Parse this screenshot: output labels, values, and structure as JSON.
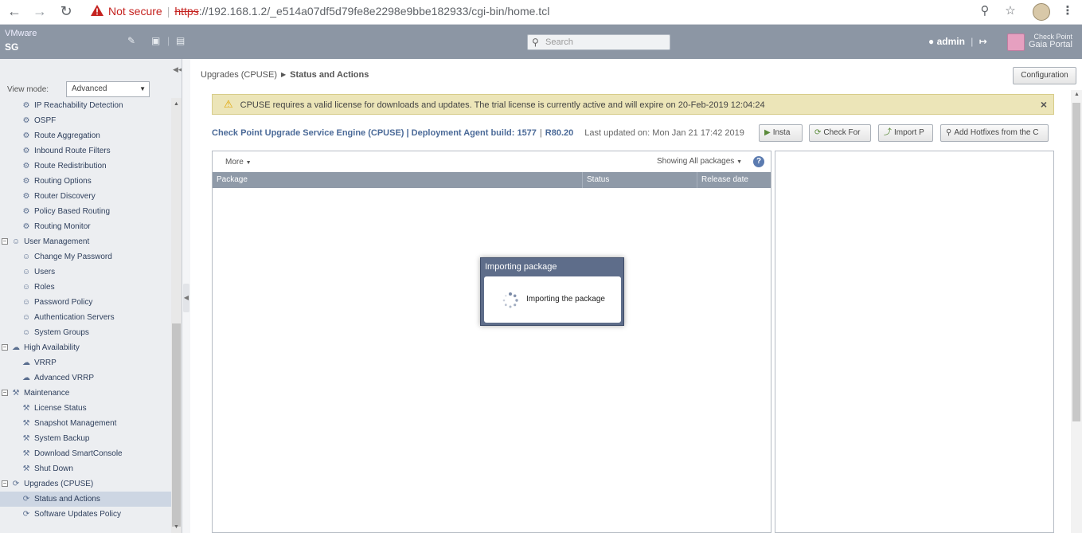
{
  "browser": {
    "not_secure": "Not secure",
    "url_scheme": "https",
    "url_rest": "://192.168.1.2/_e514a07df5d79fe8e2298e9bbe182933/cgi-bin/home.tcl"
  },
  "header": {
    "vendor": "VMware",
    "host": "SG",
    "search_placeholder": "Search",
    "user": "admin",
    "logo_line1": "Check Point",
    "logo_line2": "Gaia Portal"
  },
  "sidebar": {
    "view_mode_label": "View mode:",
    "view_mode_value": "Advanced",
    "items": [
      {
        "label": "IP Reachability Detection",
        "icon": "route-icon",
        "kind": "child"
      },
      {
        "label": "OSPF",
        "icon": "route-icon",
        "kind": "child"
      },
      {
        "label": "Route Aggregation",
        "icon": "route-icon",
        "kind": "child"
      },
      {
        "label": "Inbound Route Filters",
        "icon": "route-icon",
        "kind": "child"
      },
      {
        "label": "Route Redistribution",
        "icon": "route-icon",
        "kind": "child"
      },
      {
        "label": "Routing Options",
        "icon": "route-icon",
        "kind": "child"
      },
      {
        "label": "Router Discovery",
        "icon": "route-icon",
        "kind": "child"
      },
      {
        "label": "Policy Based Routing",
        "icon": "route-icon",
        "kind": "child"
      },
      {
        "label": "Routing Monitor",
        "icon": "route-icon",
        "kind": "child"
      },
      {
        "label": "User Management",
        "icon": "users-icon",
        "kind": "group"
      },
      {
        "label": "Change My Password",
        "icon": "users-icon",
        "kind": "child"
      },
      {
        "label": "Users",
        "icon": "users-icon",
        "kind": "child"
      },
      {
        "label": "Roles",
        "icon": "users-icon",
        "kind": "child"
      },
      {
        "label": "Password Policy",
        "icon": "users-icon",
        "kind": "child"
      },
      {
        "label": "Authentication Servers",
        "icon": "users-icon",
        "kind": "child"
      },
      {
        "label": "System Groups",
        "icon": "users-icon",
        "kind": "child"
      },
      {
        "label": "High Availability",
        "icon": "cloud-icon",
        "kind": "group"
      },
      {
        "label": "VRRP",
        "icon": "cloud-icon",
        "kind": "child"
      },
      {
        "label": "Advanced VRRP",
        "icon": "cloud-icon",
        "kind": "child"
      },
      {
        "label": "Maintenance",
        "icon": "wrench-icon",
        "kind": "group"
      },
      {
        "label": "License Status",
        "icon": "wrench-icon",
        "kind": "child"
      },
      {
        "label": "Snapshot Management",
        "icon": "wrench-icon",
        "kind": "child"
      },
      {
        "label": "System Backup",
        "icon": "wrench-icon",
        "kind": "child"
      },
      {
        "label": "Download SmartConsole",
        "icon": "wrench-icon",
        "kind": "child"
      },
      {
        "label": "Shut Down",
        "icon": "wrench-icon",
        "kind": "child"
      },
      {
        "label": "Upgrades (CPUSE)",
        "icon": "refresh-icon",
        "kind": "group"
      },
      {
        "label": "Status and Actions",
        "icon": "refresh-icon",
        "kind": "child",
        "selected": true
      },
      {
        "label": "Software Updates Policy",
        "icon": "refresh-icon",
        "kind": "child"
      }
    ]
  },
  "main": {
    "breadcrumb_parent": "Upgrades (CPUSE)",
    "breadcrumb_current": "Status and Actions",
    "configuration_label": "Configuration",
    "alert_text": "CPUSE requires a valid license for downloads and updates. The trial license is currently active and will expire on 20-Feb-2019 12:04:24",
    "deploy_title": "Check Point Upgrade Service Engine (CPUSE) | Deployment Agent build: 1577",
    "deploy_version": "R80.20",
    "last_updated": "Last updated on: Mon Jan 21 17:42 2019",
    "actions": {
      "install": "Insta",
      "check_for": "Check For",
      "import": "Import P",
      "add_hotfixes": "Add Hotfixes from the C"
    },
    "grid": {
      "more": "More",
      "showing": "Showing All packages",
      "columns": [
        "Package",
        "Status",
        "Release date"
      ]
    }
  },
  "modal": {
    "title": "Importing package",
    "message": "Importing the package"
  }
}
